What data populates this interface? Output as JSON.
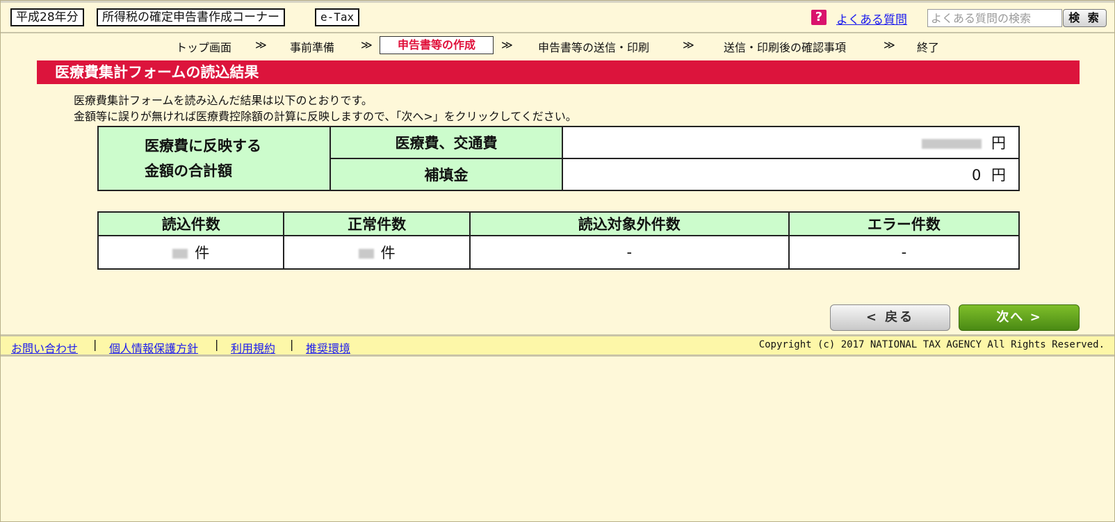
{
  "header": {
    "year_tag": "平成28年分",
    "corner_tag": "所得税の確定申告書作成コーナー",
    "etax_tag": "e-Tax",
    "faq_link": "よくある質問",
    "search_placeholder": "よくある質問の検索",
    "search_button": "検 索"
  },
  "steps": {
    "items": [
      "トップ画面",
      "事前準備",
      "申告書等の作成",
      "申告書等の送信・印刷",
      "送信・印刷後の確認事項",
      "終了"
    ],
    "separator": "≫",
    "current_index": 2
  },
  "section": {
    "title": "医療費集計フォームの読込結果",
    "intro_line1": "医療費集計フォームを読み込んだ結果は以下のとおりです。",
    "intro_line2": "金額等に誤りが無ければ医療費控除額の計算に反映しますので、「次へ>」をクリックしてください。"
  },
  "summary": {
    "row_header_line1": "医療費に反映する",
    "row_header_line2": "金額の合計額",
    "medical_label": "医療費、交通費",
    "medical_unit": "円",
    "reimbursement_label": "補填金",
    "reimbursement_value": "0",
    "reimbursement_unit": "円"
  },
  "counts": {
    "headers": [
      "読込件数",
      "正常件数",
      "読込対象外件数",
      "エラー件数"
    ],
    "unit": "件",
    "excluded_value": "-",
    "error_value": "-"
  },
  "buttons": {
    "back": "< 戻る",
    "next": "次へ >"
  },
  "footer": {
    "links": [
      "お問い合わせ",
      "個人情報保護方針",
      "利用規約",
      "推奨環境"
    ],
    "copyright": "Copyright (c) 2017 NATIONAL TAX AGENCY All Rights Reserved."
  },
  "colors": {
    "background": "#fef8d9",
    "title_bar": "#dc143c",
    "table_header": "#ccfccc",
    "next_button": "#5a9a1a",
    "link": "#1a1aee"
  }
}
